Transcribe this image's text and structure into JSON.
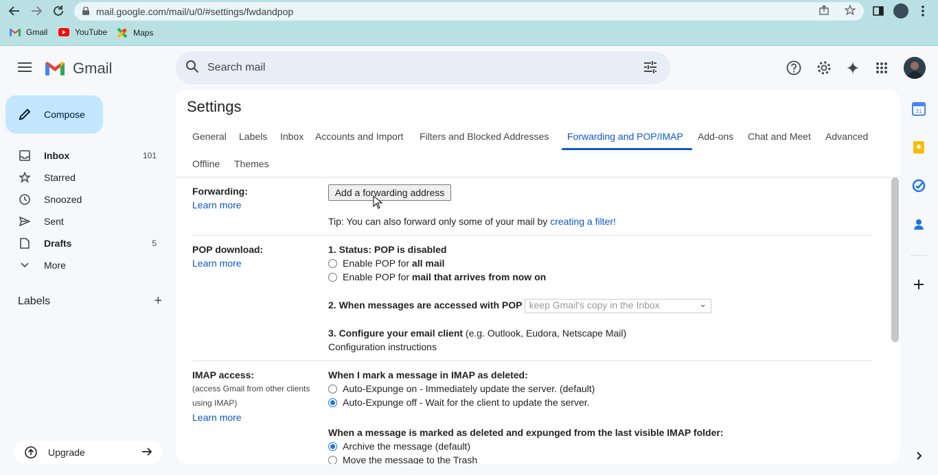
{
  "browser": {
    "url": "mail.google.com/mail/u/0/#settings/fwdandpop",
    "bookmarks": [
      {
        "label": "Gmail"
      },
      {
        "label": "YouTube"
      },
      {
        "label": "Maps"
      }
    ]
  },
  "app": {
    "name": "Gmail"
  },
  "sidebar": {
    "compose_label": "Compose",
    "items": [
      {
        "label": "Inbox",
        "count": "101",
        "icon": "inbox-icon"
      },
      {
        "label": "Starred",
        "count": "",
        "icon": "star-icon"
      },
      {
        "label": "Snoozed",
        "count": "",
        "icon": "clock-icon"
      },
      {
        "label": "Sent",
        "count": "",
        "icon": "send-icon"
      },
      {
        "label": "Drafts",
        "count": "5",
        "icon": "draft-icon"
      },
      {
        "label": "More",
        "count": "",
        "icon": "chevron-down-icon"
      }
    ],
    "labels_heading": "Labels",
    "upgrade_label": "Upgrade"
  },
  "search": {
    "placeholder": "Search mail"
  },
  "settings": {
    "title": "Settings",
    "tabs": [
      {
        "label": "General"
      },
      {
        "label": "Labels"
      },
      {
        "label": "Inbox"
      },
      {
        "label": "Accounts and Import"
      },
      {
        "label": "Filters and Blocked Addresses"
      },
      {
        "label": "Forwarding and POP/IMAP"
      },
      {
        "label": "Add-ons"
      },
      {
        "label": "Chat and Meet"
      },
      {
        "label": "Advanced"
      },
      {
        "label": "Offline"
      },
      {
        "label": "Themes"
      }
    ],
    "active_tab": "Forwarding and POP/IMAP",
    "forwarding": {
      "label": "Forwarding:",
      "learn_more": "Learn more",
      "button": "Add a forwarding address",
      "tip_text": "Tip: You can also forward only some of your mail by ",
      "tip_link": "creating a filter!"
    },
    "pop": {
      "label": "POP download:",
      "learn_more": "Learn more",
      "status": "1. Status: POP is disabled",
      "opt1_prefix": "Enable POP for ",
      "opt1_bold": "all mail",
      "opt2_prefix": "Enable POP for ",
      "opt2_bold": "mail that arrives from now on",
      "step2": "2. When messages are accessed with POP",
      "step2_select": "keep Gmail's copy in the Inbox",
      "step3_bold": "3. Configure your email client",
      "step3_rest": " (e.g. Outlook, Eudora, Netscape Mail)",
      "config_link": "Configuration instructions"
    },
    "imap": {
      "label": "IMAP access:",
      "sub1": "(access Gmail from other clients",
      "sub2": "using IMAP)",
      "learn_more": "Learn more",
      "deleted_heading": "When I mark a message in IMAP as deleted:",
      "del_opt1": "Auto-Expunge on - Immediately update the server. (default)",
      "del_opt2": "Auto-Expunge off - Wait for the client to update the server.",
      "expunged_heading": "When a message is marked as deleted and expunged from the last visible IMAP folder:",
      "exp_opt1": "Archive the message (default)",
      "exp_opt2": "Move the message to the Trash"
    }
  },
  "colors": {
    "accent": "#0b57d0",
    "compose_bg": "#c2e7ff",
    "browser_bar": "#b9e0e2"
  }
}
